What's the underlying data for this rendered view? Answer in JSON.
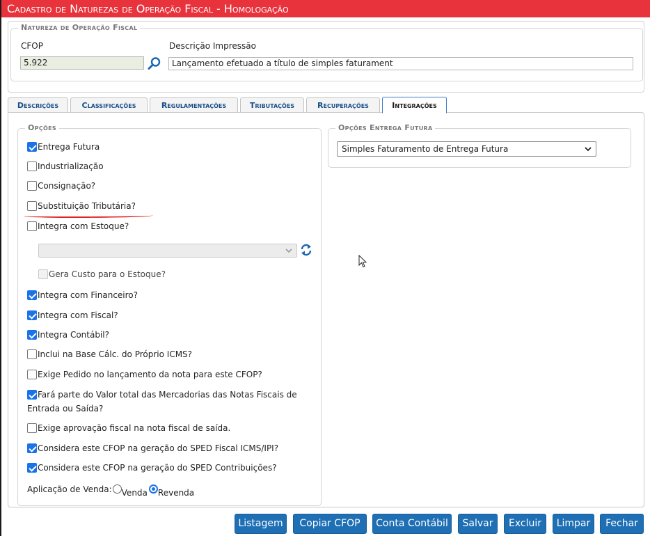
{
  "window": {
    "title": "Cadastro de Naturezas de Operação Fiscal  - Homologação"
  },
  "natureza": {
    "legend": "Natureza de Operação Fiscal",
    "cfop_label": "CFOP",
    "cfop_value": "5.922",
    "descricao_label": "Descrição Impressão",
    "descricao_value": "Lançamento efetuado a título de simples faturament"
  },
  "tabs": [
    {
      "label": "Descrições",
      "active": false
    },
    {
      "label": "Classificações",
      "active": false
    },
    {
      "label": "Regulamentações",
      "active": false
    },
    {
      "label": "Tributações",
      "active": false
    },
    {
      "label": "Recuperações",
      "active": false
    },
    {
      "label": "Integrações",
      "active": true
    }
  ],
  "opcoes": {
    "legend": "Opções",
    "items": [
      {
        "label": "Entrega Futura",
        "checked": true
      },
      {
        "label": "Industrialização",
        "checked": false
      },
      {
        "label": "Consignação?",
        "checked": false
      },
      {
        "label": "Substituição Tributária?",
        "checked": false
      },
      {
        "label": "Integra com Estoque?",
        "checked": false
      }
    ],
    "estoque_select_value": "",
    "gera_custo_label": "Gera Custo para o Estoque?",
    "gera_custo_checked": false,
    "items2": [
      {
        "label": "Integra com Financeiro?",
        "checked": true
      },
      {
        "label": "Integra com Fiscal?",
        "checked": true
      },
      {
        "label": "Integra Contábil?",
        "checked": true
      },
      {
        "label": "Inclui na Base Cálc. do Próprio ICMS?",
        "checked": false
      },
      {
        "label": "Exige Pedido no lançamento da nota para este CFOP?",
        "checked": false
      }
    ],
    "valor_total_line1": "Fará parte do Valor total das Mercadorias das Notas Fiscais de",
    "valor_total_line2": "Entrada ou Saída?",
    "valor_total_checked": true,
    "items3": [
      {
        "label": "Exige aprovação fiscal na nota fiscal de saída.",
        "checked": false
      },
      {
        "label": "Considera este CFOP na geração do SPED Fiscal ICMS/IPI?",
        "checked": true
      },
      {
        "label": "Considera este CFOP na geração do SPED Contribuições?",
        "checked": true
      }
    ],
    "aplicacao_label": "Aplicação de Venda:",
    "aplicacao_options": [
      {
        "label": "Venda",
        "checked": false
      },
      {
        "label": "Revenda",
        "checked": true
      }
    ]
  },
  "entrega_futura": {
    "legend": "Opções Entrega Futura",
    "select_value": "Simples Faturamento de Entrega Futura"
  },
  "buttons": {
    "listagem": "Listagem",
    "copiar_cfop": "Copiar CFOP",
    "conta_contabil": "Conta Contábil",
    "salvar": "Salvar",
    "excluir": "Excluir",
    "limpar": "Limpar",
    "fechar": "Fechar"
  },
  "colors": {
    "title_bar": "#e8333d",
    "button": "#1f6fb5",
    "checkbox_checked": "#1a73e8",
    "tab_text": "#1a4f8a",
    "annotation_underline": "#e02020"
  }
}
